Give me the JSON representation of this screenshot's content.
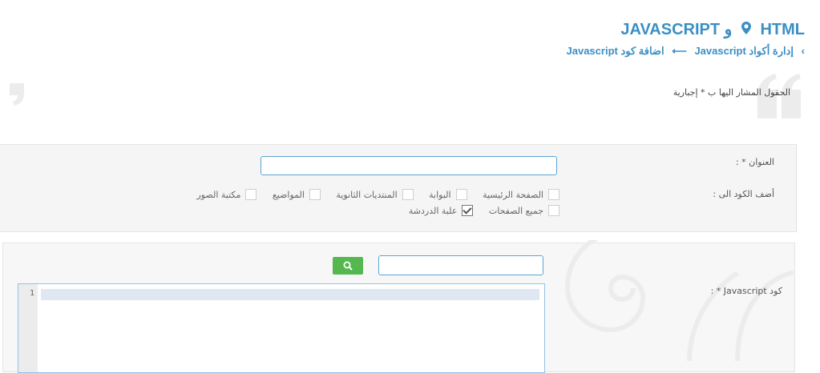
{
  "header": {
    "title_part1": "HTML",
    "title_conj": "و",
    "title_part2": "JAVASCRIPT",
    "breadcrumb_parent": "إدارة أكواد Javascript",
    "breadcrumb_arrow": "⟵",
    "breadcrumb_current": "اضافة كود Javascript"
  },
  "required_note": "الحقول المشار اليها ب * إجبارية",
  "form": {
    "title_label": "العنوان * :",
    "title_value": "",
    "add_to_label": "أضف الكود الى :",
    "targets": [
      {
        "label": "الصفحة الرئيسية",
        "checked": false
      },
      {
        "label": "البوابة",
        "checked": false
      },
      {
        "label": "المنتديات الثانوية",
        "checked": false
      },
      {
        "label": "المواضيع",
        "checked": false
      },
      {
        "label": "مكتبة الصور",
        "checked": false
      }
    ],
    "targets_row2": [
      {
        "label": "جميع الصفحات",
        "checked": false
      },
      {
        "label": "علبة الدردشة",
        "checked": true
      }
    ]
  },
  "code": {
    "label": "كود Javascript * :",
    "search_value": "",
    "line_numbers": [
      "1"
    ]
  },
  "colors": {
    "accent": "#3b8fc4",
    "button_green": "#54b84f"
  }
}
